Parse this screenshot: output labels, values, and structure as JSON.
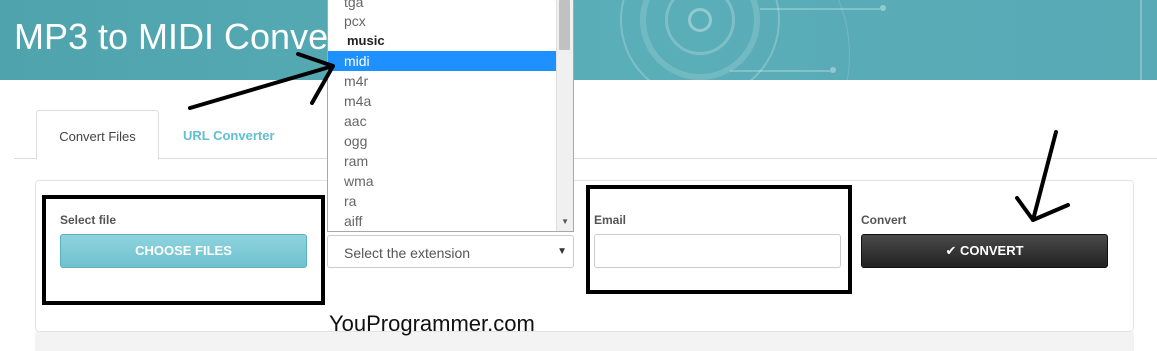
{
  "header": {
    "title": "MP3 to MIDI Conver"
  },
  "tabs": [
    {
      "label": "Convert Files",
      "active": true
    },
    {
      "label": "URL Converter",
      "active": false
    }
  ],
  "form": {
    "select_file_label": "Select file",
    "choose_files_label": "CHOOSE FILES",
    "extension_placeholder": "Select the extension",
    "email_label": "Email",
    "email_value": "",
    "convert_label": "Convert",
    "convert_button_label": "CONVERT",
    "convert_button_icon": "check-icon"
  },
  "dropdown": {
    "options": [
      {
        "label": "tga",
        "type": "option"
      },
      {
        "label": "pcx",
        "type": "option"
      },
      {
        "label": "music",
        "type": "group"
      },
      {
        "label": "midi",
        "type": "option",
        "selected": true
      },
      {
        "label": "m4r",
        "type": "option"
      },
      {
        "label": "m4a",
        "type": "option"
      },
      {
        "label": "aac",
        "type": "option"
      },
      {
        "label": "ogg",
        "type": "option"
      },
      {
        "label": "ram",
        "type": "option"
      },
      {
        "label": "wma",
        "type": "option"
      },
      {
        "label": "ra",
        "type": "option"
      },
      {
        "label": "aiff",
        "type": "option"
      }
    ]
  },
  "watermark": "YouProgrammer.com",
  "colors": {
    "banner": "#58aab5",
    "choose_button": "#7ccad6",
    "convert_button": "#2b2b2b",
    "selected_option": "#1e90ff",
    "url_tab": "#5fbfd0"
  }
}
